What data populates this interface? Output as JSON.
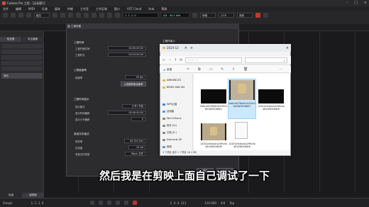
{
  "titlebar": {
    "title": "Cubase Pro 工程 - [无标题1]"
  },
  "menu": [
    "文件",
    "编辑",
    "MIDI",
    "乐谱",
    "媒体",
    "传输",
    "工作室",
    "工作区域",
    "窗口",
    "VST Cloud",
    "Hub",
    "帮助"
  ],
  "toolbar": {
    "mode_select": "触控",
    "time_display": "1. 1. 1. 0",
    "time_display2": "4/4 · 44.1 kHz",
    "snap_select": "网格",
    "quant_select": "1/16",
    "zoom_select": "音频"
  },
  "left_panel": {
    "tabs": [
      "检查器",
      "可见通道"
    ],
    "track_name": "音轨"
  },
  "bottom_tabs": [
    "轨道",
    "编辑器"
  ],
  "transport": {
    "position": "1. 1. 1. 0",
    "position_right": "2. 4. 4. 111",
    "tempo": "120.000",
    "signature": "4/4",
    "tap": "Tap",
    "mode": "Simple"
  },
  "dialog": {
    "title": "工程设置",
    "right_header": "工程作者人",
    "sections": {
      "time": "工程时间",
      "framerate": "工程帧速率",
      "display": "工程时间显示",
      "record": "录音文件格式"
    },
    "rows": {
      "start_label": "工程开始时间",
      "start_value": "00:00:00:00",
      "length_label": "工程时长",
      "length_value": "00:10:00:00",
      "fps_label": "帧速率",
      "fps_value": "30 fps",
      "from_video_button": "从视频获取帧速率",
      "display_label": "显示格式",
      "display_value": "小节+节拍",
      "offset_label": "显示时间偏移",
      "offset_value": "00:00:00:00",
      "bar_offset_label": "显示小节偏移",
      "bar_offset_value": "0",
      "samplerate_label": "采样率",
      "samplerate_value": "44.100 kHz",
      "bitdepth_label": "位深度",
      "bitdepth_value": "24 bit",
      "filetype_label": "录音文件类型",
      "filetype_value": "Wave 文件"
    },
    "ok_button": "确定",
    "cancel_button": "取消"
  },
  "explorer": {
    "title": "2024-12",
    "path": "2024-12",
    "new_label": "新建",
    "nav_items": [
      "AMBIENCES",
      "BIRDS AND AN",
      "WPS云盘",
      "此电脑",
      "Win11Home",
      "软件 (D:)",
      "文档 (E:)",
      "Elements SE",
      "网络"
    ],
    "files": [
      {
        "name": "5a6c4d378efd7a1f10c06e18e5016801",
        "kind": "video-black"
      },
      {
        "name": "5a6c4d378efd7a1f10c06e18e5016801",
        "kind": "video-film"
      },
      {
        "name": "14341e3cba4ca299c0a4610962064f8",
        "kind": "video-black"
      },
      {
        "name": "14341e3cba4ca299c0a4610962064f8",
        "kind": "video-film"
      },
      {
        "name": "14341e3cba4ca299c0a4610962064f8",
        "kind": "document"
      }
    ],
    "status": "5 个项目   选中 1 个项目 16.2 MB"
  },
  "subtitle": "然后我是在剪映上面自己调试了一下",
  "colors": {
    "accent_red": "#d84a35",
    "dialog_bg": "#2c2c2f",
    "explorer_bg": "#f3f3f3",
    "selection": "#cce8ff"
  }
}
